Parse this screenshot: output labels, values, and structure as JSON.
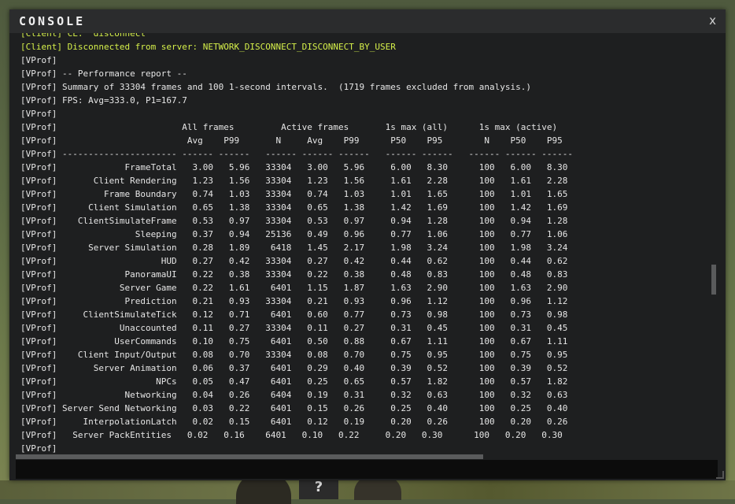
{
  "console": {
    "title": "CONSOLE",
    "close_label": "x",
    "input_value": "",
    "input_placeholder": ""
  },
  "help_label": "?",
  "log": {
    "lines": [
      {
        "text": "[Client] CL:  disconnect",
        "kind": "client"
      },
      {
        "text": "[Client] Disconnected from server: NETWORK_DISCONNECT_DISCONNECT_BY_USER",
        "kind": "client"
      },
      {
        "text": "[VProf]",
        "kind": "vprof"
      },
      {
        "text": "[VProf] -- Performance report --",
        "kind": "vprof"
      },
      {
        "text": "[VProf] Summary of 33304 frames and 100 1-second intervals.  (1719 frames excluded from analysis.)",
        "kind": "vprof"
      },
      {
        "text": "[VProf] FPS: Avg=333.0, P1=167.7",
        "kind": "vprof"
      },
      {
        "text": "[VProf]",
        "kind": "vprof"
      },
      {
        "text": "[VProf]                        All frames         Active frames       1s max (all)      1s max (active)",
        "kind": "vprof"
      },
      {
        "text": "[VProf]                         Avg    P99       N     Avg    P99      P50    P95        N    P50    P95",
        "kind": "vprof"
      },
      {
        "text": "[VProf] ---------------------- ------ ------   ------ ------ ------   ------ ------   ------ ------ ------",
        "kind": "vprof"
      },
      {
        "text": "[VProf]             FrameTotal   3.00   5.96   33304   3.00   5.96     6.00   8.30      100   6.00   8.30",
        "kind": "vprof"
      },
      {
        "text": "[VProf]       Client Rendering   1.23   1.56   33304   1.23   1.56     1.61   2.28      100   1.61   2.28",
        "kind": "vprof"
      },
      {
        "text": "[VProf]         Frame Boundary   0.74   1.03   33304   0.74   1.03     1.01   1.65      100   1.01   1.65",
        "kind": "vprof"
      },
      {
        "text": "[VProf]      Client Simulation   0.65   1.38   33304   0.65   1.38     1.42   1.69      100   1.42   1.69",
        "kind": "vprof"
      },
      {
        "text": "[VProf]    ClientSimulateFrame   0.53   0.97   33304   0.53   0.97     0.94   1.28      100   0.94   1.28",
        "kind": "vprof"
      },
      {
        "text": "[VProf]               Sleeping   0.37   0.94   25136   0.49   0.96     0.77   1.06      100   0.77   1.06",
        "kind": "vprof"
      },
      {
        "text": "[VProf]      Server Simulation   0.28   1.89    6418   1.45   2.17     1.98   3.24      100   1.98   3.24",
        "kind": "vprof"
      },
      {
        "text": "[VProf]                    HUD   0.27   0.42   33304   0.27   0.42     0.44   0.62      100   0.44   0.62",
        "kind": "vprof"
      },
      {
        "text": "[VProf]             PanoramaUI   0.22   0.38   33304   0.22   0.38     0.48   0.83      100   0.48   0.83",
        "kind": "vprof"
      },
      {
        "text": "[VProf]            Server Game   0.22   1.61    6401   1.15   1.87     1.63   2.90      100   1.63   2.90",
        "kind": "vprof"
      },
      {
        "text": "[VProf]             Prediction   0.21   0.93   33304   0.21   0.93     0.96   1.12      100   0.96   1.12",
        "kind": "vprof"
      },
      {
        "text": "[VProf]     ClientSimulateTick   0.12   0.71    6401   0.60   0.77     0.73   0.98      100   0.73   0.98",
        "kind": "vprof"
      },
      {
        "text": "[VProf]            Unaccounted   0.11   0.27   33304   0.11   0.27     0.31   0.45      100   0.31   0.45",
        "kind": "vprof"
      },
      {
        "text": "[VProf]           UserCommands   0.10   0.75    6401   0.50   0.88     0.67   1.11      100   0.67   1.11",
        "kind": "vprof"
      },
      {
        "text": "[VProf]    Client Input/Output   0.08   0.70   33304   0.08   0.70     0.75   0.95      100   0.75   0.95",
        "kind": "vprof"
      },
      {
        "text": "[VProf]       Server Animation   0.06   0.37    6401   0.29   0.40     0.39   0.52      100   0.39   0.52",
        "kind": "vprof"
      },
      {
        "text": "[VProf]                   NPCs   0.05   0.47    6401   0.25   0.65     0.57   1.82      100   0.57   1.82",
        "kind": "vprof"
      },
      {
        "text": "[VProf]             Networking   0.04   0.26    6404   0.19   0.31     0.32   0.63      100   0.32   0.63",
        "kind": "vprof"
      },
      {
        "text": "[VProf] Server Send Networking   0.03   0.22    6401   0.15   0.26     0.25   0.40      100   0.25   0.40",
        "kind": "vprof"
      },
      {
        "text": "[VProf]     InterpolationLatch   0.02   0.15    6401   0.12   0.19     0.20   0.26      100   0.20   0.26",
        "kind": "vprof"
      },
      {
        "text": "[VProf]   Server PackEntities   0.02   0.16    6401   0.10   0.22     0.20   0.30      100   0.20   0.30",
        "kind": "vprof"
      },
      {
        "text": "[VProf]",
        "kind": "vprof"
      }
    ]
  }
}
